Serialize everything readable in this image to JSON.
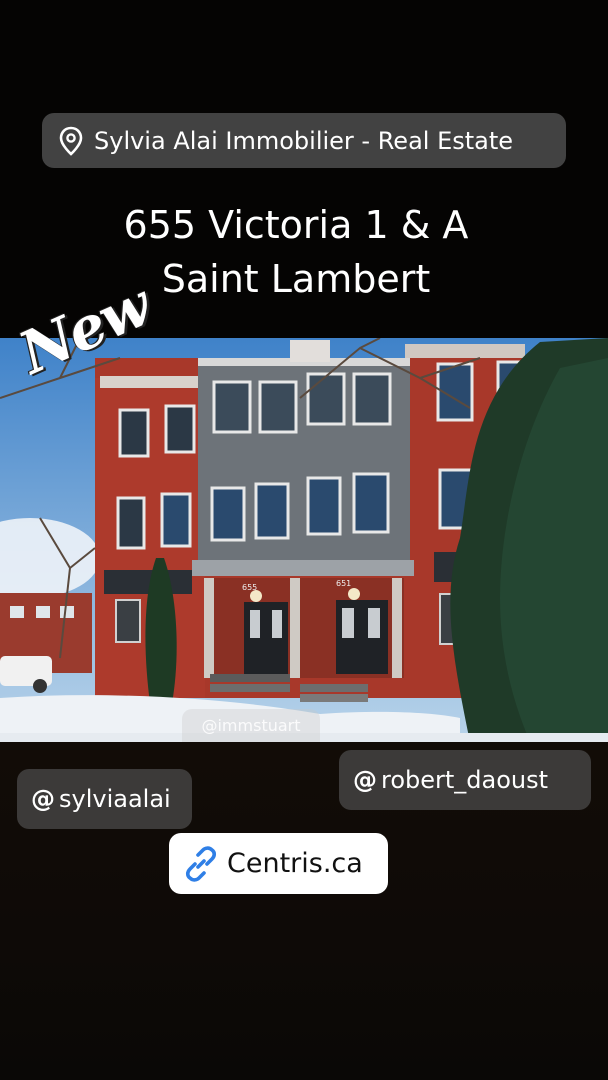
{
  "location": {
    "label": "Sylvia Alai Immobilier -  Real Estate",
    "icon": "location-pin-icon"
  },
  "title": {
    "line1": "655 Victoria 1 & A",
    "line2": "Saint Lambert"
  },
  "new_sticker": {
    "text": "New"
  },
  "photo_watermark": {
    "text": "@immstuart"
  },
  "photo_signs": {
    "door_left": "655",
    "door_right": "651"
  },
  "mentions": [
    {
      "symbol": "@",
      "handle": "sylviaalai"
    },
    {
      "symbol": "@",
      "handle": "robert_daoust"
    }
  ],
  "link": {
    "label": "Centris.ca",
    "icon": "link-icon",
    "accent": "#2f7fe6"
  },
  "colors": {
    "sticker_gray": "#484848",
    "mention_gray": "#3c3a39",
    "brick": "#a8382a"
  }
}
